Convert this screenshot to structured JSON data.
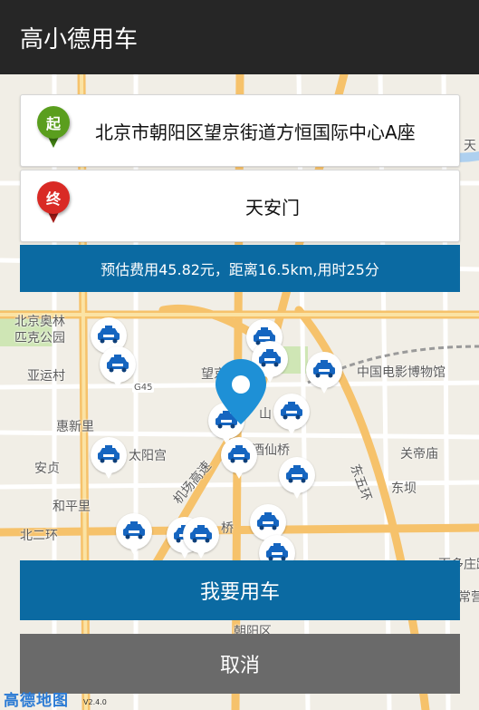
{
  "app": {
    "title": "高小德用车"
  },
  "route": {
    "start": {
      "badge": "起",
      "address": "北京市朝阳区望京街道方恒国际中心A座",
      "color": "#5a9e1e"
    },
    "end": {
      "badge": "终",
      "address": "天安门",
      "color": "#d92a25"
    }
  },
  "estimate": {
    "text": "预估费用45.82元，距离16.5km,用时25分"
  },
  "actions": {
    "request_label": "我要用车",
    "cancel_label": "取消"
  },
  "map": {
    "labels": {
      "olympic_line1": "北京奥林",
      "olympic_line2": "匹克公园",
      "yayuncun": "亚运村",
      "huixinli": "惠新里",
      "anzhen": "安贞",
      "hepingli": "和平里",
      "beierhuan": "北二环",
      "taiyanggong": "太阳宫",
      "wangjing": "望京",
      "jiuxianqiao": "酒仙桥",
      "airport_expressway": "机场高速",
      "film_museum": "中国电影博物馆",
      "guanzhuangmiao": "关帝庙",
      "dongba": "东坝",
      "dongwuhuan": "东五环",
      "chaoyang": "朝阳区",
      "qiao": "桥",
      "tian": "天",
      "g45": "G45",
      "shan": "山",
      "right_road": "一百多庄路",
      "right_label2": "常营"
    },
    "logo_text": "高德地图",
    "version_text": "V2.4.0",
    "colors": {
      "road_major": "#f6c26b",
      "road_minor": "#ffffff",
      "water": "#aed0ef",
      "green": "#cfe6b5",
      "accent": "#0b6aa2",
      "location": "#1e90d6"
    }
  },
  "icons": {
    "taxi": "taxi-icon",
    "location_pin": "location-pin-icon",
    "locate": "navigation-arrow-icon"
  }
}
